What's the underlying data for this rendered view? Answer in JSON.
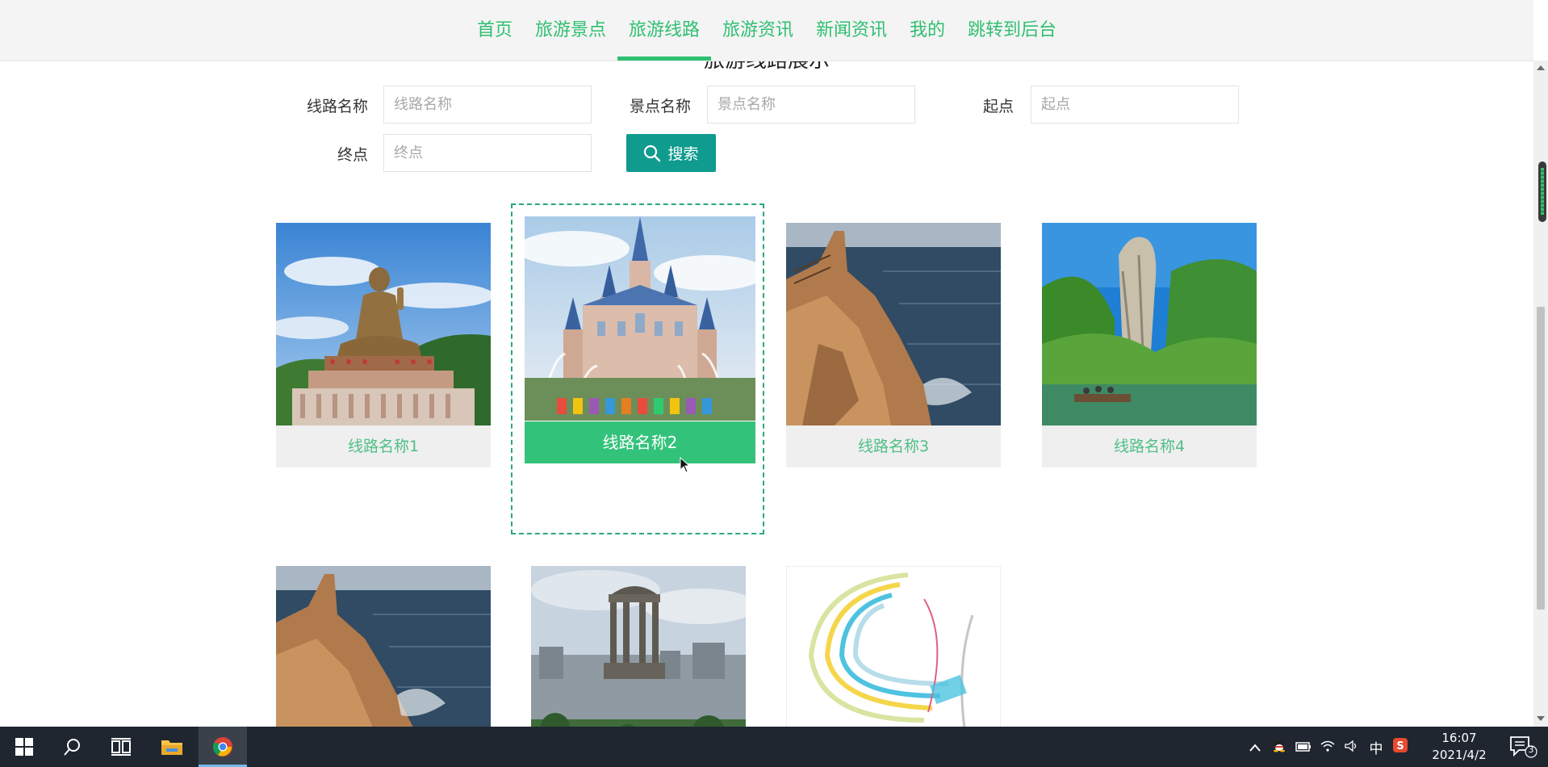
{
  "nav": {
    "items": [
      {
        "label": "首页",
        "active": false
      },
      {
        "label": "旅游景点",
        "active": false
      },
      {
        "label": "旅游线路",
        "active": true
      },
      {
        "label": "旅游资讯",
        "active": false
      },
      {
        "label": "新闻资讯",
        "active": false
      },
      {
        "label": "我的",
        "active": false
      },
      {
        "label": "跳转到后台",
        "active": false
      }
    ],
    "accent_color": "#2fbf71"
  },
  "page": {
    "section_title": "旅游线路展示"
  },
  "search": {
    "route_name_label": "线路名称",
    "route_name_placeholder": "线路名称",
    "spot_name_label": "景点名称",
    "spot_name_placeholder": "景点名称",
    "start_label": "起点",
    "start_placeholder": "起点",
    "end_label": "终点",
    "end_placeholder": "终点",
    "button_label": "搜索",
    "button_color": "#0f9b8e"
  },
  "routes": [
    {
      "name": "线路名称1",
      "image": "buddha-statue-image"
    },
    {
      "name": "线路名称2",
      "image": "castle-image",
      "hovered": true
    },
    {
      "name": "线路名称3",
      "image": "sea-cliff-image"
    },
    {
      "name": "线路名称4",
      "image": "rock-mountain-lake-image"
    },
    {
      "name": "",
      "image": "sea-cliff-image"
    },
    {
      "name": "",
      "image": "monument-city-image"
    },
    {
      "name": "",
      "image": "cable-illustration-image"
    }
  ],
  "taskbar": {
    "time": "16:07",
    "date": "2021/4/2",
    "ime": "中",
    "notifications": "3"
  }
}
